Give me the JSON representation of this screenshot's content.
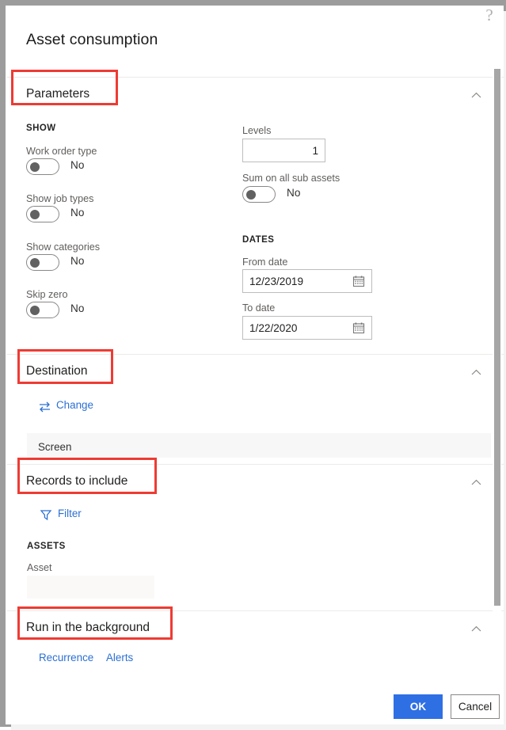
{
  "window": {
    "help_icon": "question-mark-icon"
  },
  "dialog": {
    "title": "Asset consumption"
  },
  "sections": [
    {
      "id": "parameters",
      "label": "Parameters",
      "collapse_icon": "chevron-up-icon",
      "annotated": true
    },
    {
      "id": "destination",
      "label": "Destination",
      "collapse_icon": "chevron-up-icon",
      "annotated": true
    },
    {
      "id": "records",
      "label": "Records to include",
      "collapse_icon": "chevron-up-icon",
      "annotated": true
    },
    {
      "id": "background",
      "label": "Run in the background",
      "collapse_icon": "chevron-up-icon",
      "annotated": true
    }
  ],
  "parameters": {
    "show_group_title": "SHOW",
    "dates_group_title": "DATES",
    "toggles": [
      {
        "label": "Work order type",
        "value": "No"
      },
      {
        "label": "Show job types",
        "value": "No"
      },
      {
        "label": "Show categories",
        "value": "No"
      },
      {
        "label": "Skip zero",
        "value": "No"
      }
    ],
    "levels": {
      "label": "Levels",
      "value": "1"
    },
    "sum_sub_assets": {
      "label": "Sum on all sub assets",
      "value": "No"
    },
    "from_date": {
      "label": "From date",
      "value": "12/23/2019",
      "icon": "calendar-icon"
    },
    "to_date": {
      "label": "To date",
      "value": "1/22/2020",
      "icon": "calendar-icon"
    }
  },
  "destination": {
    "change_link": {
      "label": "Change",
      "icon": "swap-arrows-icon"
    },
    "value": "Screen"
  },
  "records": {
    "filter_link": {
      "label": "Filter",
      "icon": "funnel-icon"
    },
    "assets_group_title": "ASSETS",
    "asset_field": {
      "label": "Asset",
      "value": ""
    }
  },
  "background": {
    "links": [
      {
        "label": "Recurrence"
      },
      {
        "label": "Alerts"
      }
    ]
  },
  "footer": {
    "ok_label": "OK",
    "cancel_label": "Cancel"
  },
  "colors": {
    "accent_blue": "#2f6fe4",
    "annotation_red": "#ee3b33",
    "toggle_knob": "#616161",
    "field_fill": "#faf9f8",
    "value_row": "#f7f7f7"
  }
}
